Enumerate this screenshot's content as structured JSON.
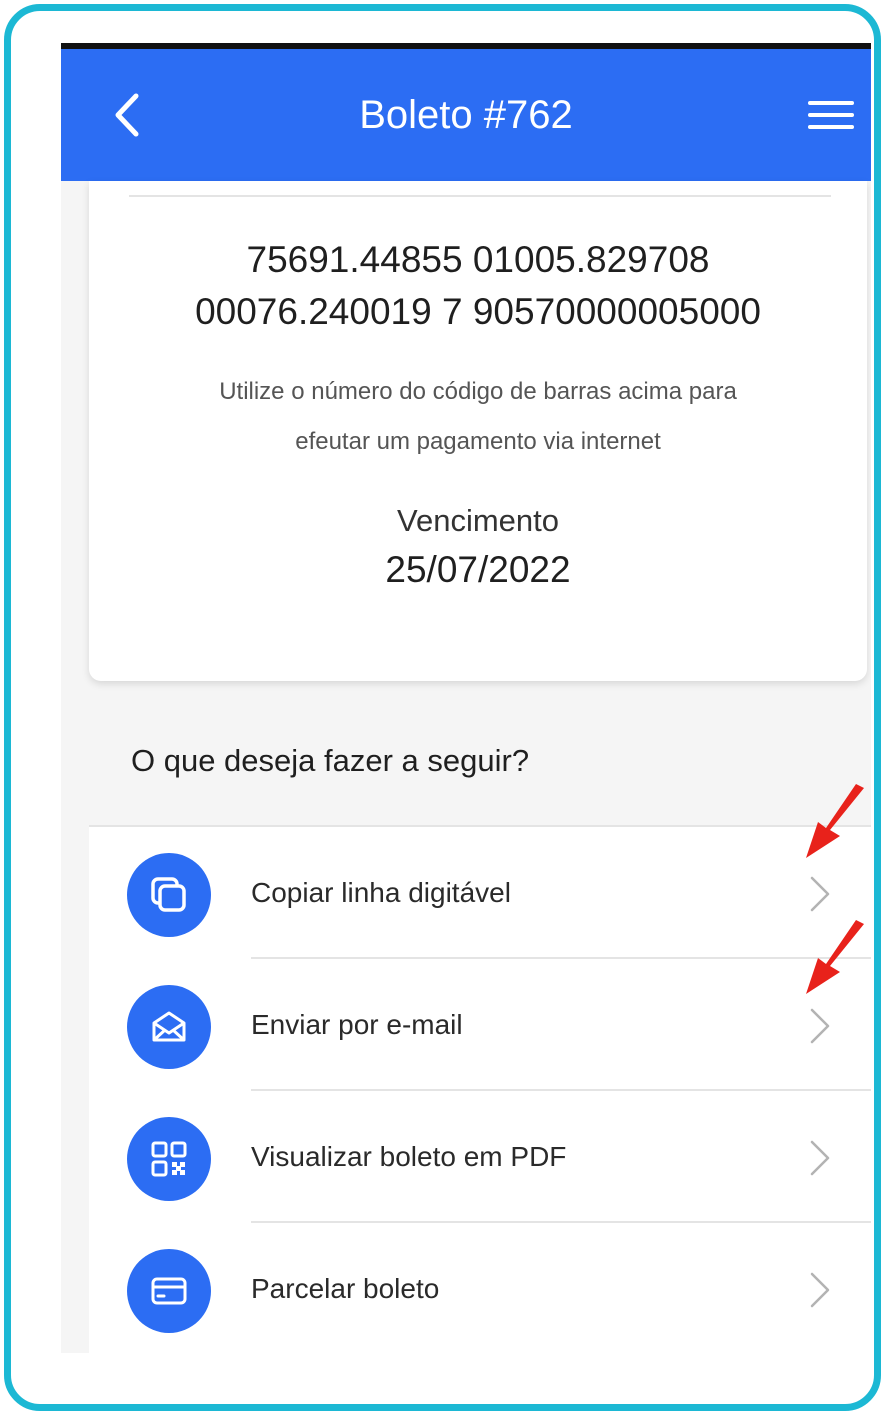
{
  "header": {
    "title": "Boleto #762"
  },
  "card": {
    "barcode_line_1": "75691.44855 01005.829708",
    "barcode_line_2": "00076.240019 7 90570000005000",
    "hint_line_1": "Utilize o número do código de barras acima para",
    "hint_line_2": "efeutar um pagamento via internet",
    "due_label": "Vencimento",
    "due_date": "25/07/2022"
  },
  "actions": {
    "title": "O que deseja fazer a seguir?",
    "items": [
      {
        "label": "Copiar linha digitável",
        "icon": "copy-icon"
      },
      {
        "label": "Enviar por e-mail",
        "icon": "envelope-icon"
      },
      {
        "label": "Visualizar boleto em PDF",
        "icon": "qr-code-icon"
      },
      {
        "label": "Parcelar boleto",
        "icon": "card-icon"
      }
    ]
  },
  "colors": {
    "primary": "#2c6df3",
    "frame": "#1cb8d4",
    "annotation": "#e8221b"
  }
}
